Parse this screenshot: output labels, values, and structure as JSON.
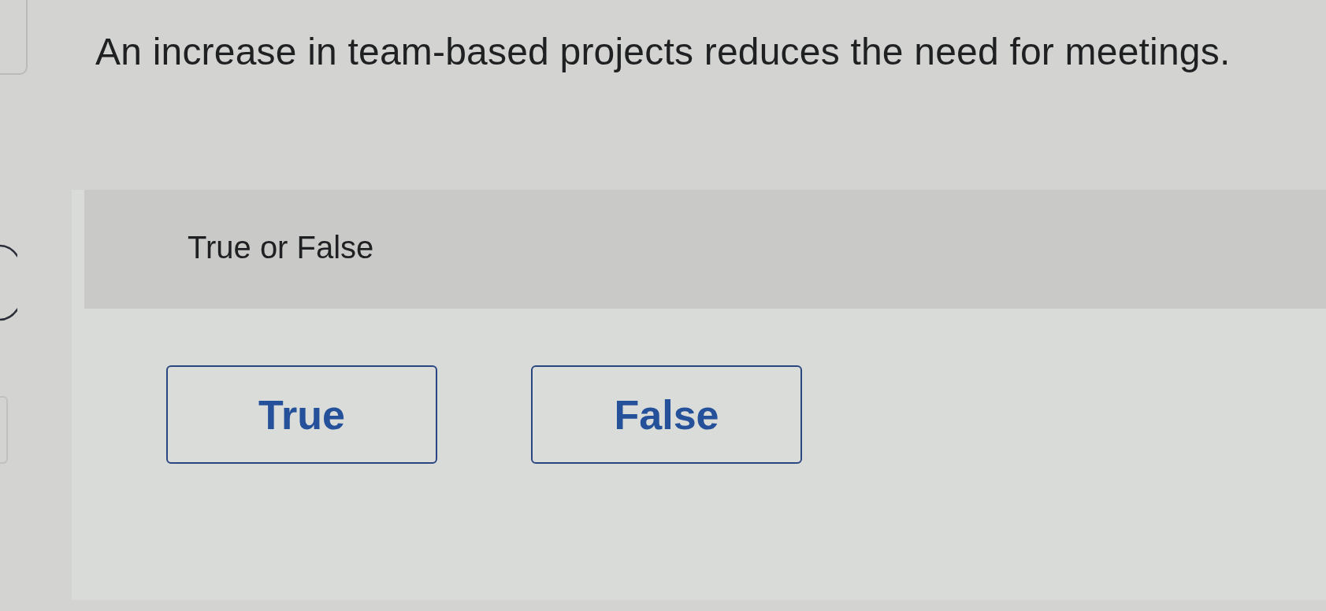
{
  "question": {
    "text": "An increase in team-based projects reduces the need for meetings."
  },
  "prompt": {
    "text": "True or False"
  },
  "options": [
    {
      "label": "True",
      "selected": false
    },
    {
      "label": "False",
      "selected": false
    }
  ]
}
